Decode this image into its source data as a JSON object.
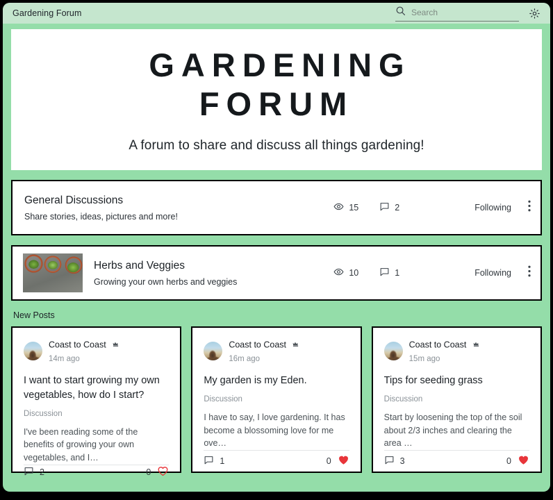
{
  "window": {
    "topbar": {
      "title": "Gardening Forum",
      "search_placeholder": "Search",
      "search_value": "",
      "search_icon": "search-icon",
      "settings_icon": "gear-icon"
    }
  },
  "hero": {
    "title": "GARDENING FORUM",
    "subtitle": "A forum to share and discuss all things gardening!"
  },
  "categories": [
    {
      "name": "General Discussions",
      "description": "Share stories, ideas, pictures and more!",
      "views": "15",
      "comments": "2",
      "follow_label": "Following",
      "has_thumbnail": false,
      "views_icon": "eye-icon",
      "comments_icon": "comment-icon",
      "more_icon": "more-vertical-icon"
    },
    {
      "name": "Herbs and Veggies",
      "description": "Growing your own herbs and veggies",
      "views": "10",
      "comments": "1",
      "follow_label": "Following",
      "has_thumbnail": true,
      "thumbnail_alt": "potted-herbs-photo",
      "views_icon": "eye-icon",
      "comments_icon": "comment-icon",
      "more_icon": "more-vertical-icon"
    }
  ],
  "new_posts": {
    "label": "New Posts",
    "items": [
      {
        "author": "Coast to Coast",
        "badge_icon": "crown-icon",
        "time": "14m ago",
        "title": "I want to start growing my own vegetables, how do I start?",
        "category": "Discussion",
        "excerpt": "I've been reading some of the benefits of growing your own vegetables, and I…",
        "comments": "2",
        "likes": "0",
        "liked": false
      },
      {
        "author": "Coast to Coast",
        "badge_icon": "crown-icon",
        "time": "16m ago",
        "title": "My garden is my Eden.",
        "category": "Discussion",
        "excerpt": "I have to say, I love gardening. It has become a blossoming love for me ove…",
        "comments": "1",
        "likes": "0",
        "liked": true
      },
      {
        "author": "Coast to Coast",
        "badge_icon": "crown-icon",
        "time": "15m ago",
        "title": "Tips for seeding grass",
        "category": "Discussion",
        "excerpt": "Start by loosening the top of the soil about 2/3 inches and clearing the area …",
        "comments": "3",
        "likes": "0",
        "liked": true
      }
    ]
  },
  "colors": {
    "page_background": "#94dda9",
    "topbar_background": "#c5e6ce",
    "card_background": "#ffffff",
    "card_border": "#000000",
    "heart_red": "#e8353a",
    "text_primary": "#1c2126",
    "text_muted": "#8a9197"
  }
}
